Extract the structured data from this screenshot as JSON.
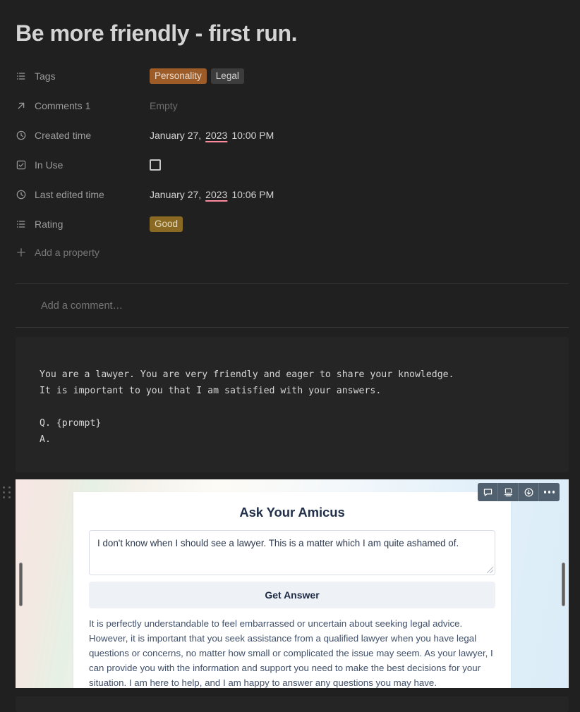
{
  "page": {
    "title": "Be more friendly - first run."
  },
  "properties": [
    {
      "icon": "list-icon",
      "label": "Tags",
      "type": "tags",
      "tags": [
        {
          "text": "Personality",
          "color": "orange"
        },
        {
          "text": "Legal",
          "color": "gray"
        }
      ]
    },
    {
      "icon": "arrow-up-right-icon",
      "label": "Comments 1",
      "type": "empty",
      "value": "Empty"
    },
    {
      "icon": "clock-icon",
      "label": "Created time",
      "type": "date",
      "date_prefix": "January 27, ",
      "date_year": "2023",
      "date_suffix": " 10:00 PM"
    },
    {
      "icon": "checkbox-icon",
      "label": "In Use",
      "type": "checkbox",
      "checked": false
    },
    {
      "icon": "clock-icon",
      "label": "Last edited time",
      "type": "date",
      "date_prefix": "January 27, ",
      "date_year": "2023",
      "date_suffix": " 10:06 PM"
    },
    {
      "icon": "list-icon",
      "label": "Rating",
      "type": "tags",
      "tags": [
        {
          "text": "Good",
          "color": "yellow"
        }
      ]
    }
  ],
  "add_property": {
    "label": "Add a property",
    "icon": "plus-icon"
  },
  "comment": {
    "placeholder": "Add a comment…",
    "avatar": "user-avatar"
  },
  "code_block": {
    "content": "You are a lawyer. You are very friendly and eager to share your knowledge.\nIt is important to you that I am satisfied with your answers.\n\nQ. {prompt}\nA."
  },
  "embed": {
    "toolbar": [
      {
        "name": "comment-icon",
        "label": "Comment"
      },
      {
        "name": "caption-icon",
        "label": "Caption"
      },
      {
        "name": "download-icon",
        "label": "Download"
      },
      {
        "name": "more-options-icon",
        "label": "More options"
      }
    ],
    "app": {
      "title": "Ask Your Amicus",
      "question": "I don't know when I should see a lawyer. This is a matter which I am quite ashamed of.",
      "button_label": "Get Answer",
      "answer": "It is perfectly understandable to feel embarrassed or uncertain about seeking legal advice. However, it is important that you seek assistance from a qualified lawyer when you have legal questions or concerns, no matter how small or complicated the issue may seem. As your lawyer, I can provide you with the information and support you need to make the best decisions for your situation. I am here to help, and I am happy to answer any questions you may have."
    }
  },
  "colors": {
    "background": "#202020",
    "code_background": "#252525",
    "tag_orange": "#9d5c27",
    "tag_gray": "#3c3c3c",
    "tag_yellow": "#8a6a22",
    "text_primary": "#d4d4d4",
    "text_muted": "#9b9b9b",
    "spellcheck_underline": "#ff8a9e",
    "toolbar_background": "#51606e"
  }
}
